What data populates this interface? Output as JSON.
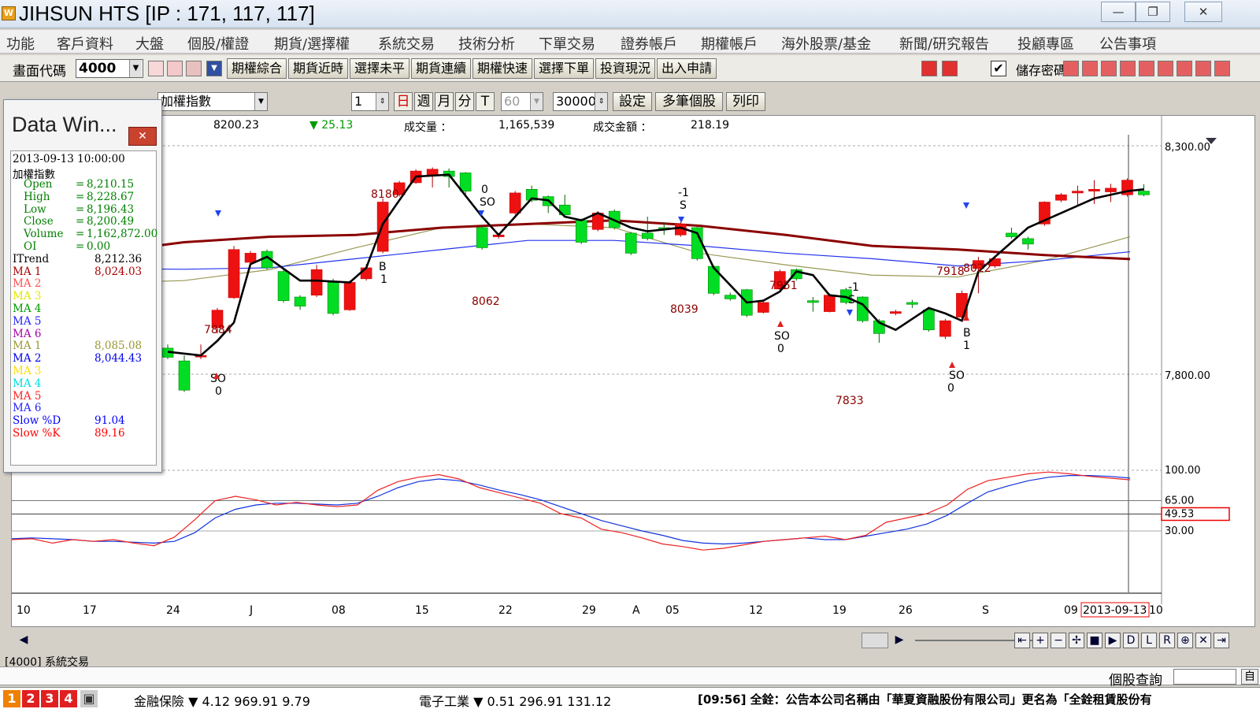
{
  "window": {
    "logo": "W",
    "title": "JIHSUN HTS      [IP : 171, 117, 117]",
    "min_glyph": "—",
    "max_glyph": "❐",
    "close_glyph": "✕"
  },
  "menu": [
    "功能",
    "客戶資料",
    "大盤",
    "個股/權證",
    "期貨/選擇權",
    "系統交易",
    "技術分析",
    "下單交易",
    "證券帳戶",
    "期權帳戶",
    "海外股票/基金",
    "新聞/研究報告",
    "投顧專區",
    "公告事項"
  ],
  "toolbar": {
    "code_label": "畫面代碼",
    "code_value": "4000",
    "buttons": [
      "期權綜合",
      "期貨近時",
      "選擇未平",
      "期貨連續",
      "期權快速",
      "選擇下單",
      "投資現況",
      "出入申請"
    ],
    "save_label": "儲存密碼"
  },
  "options": {
    "index_select": "加權指數",
    "count_value": "1",
    "periods": [
      "日",
      "週",
      "月",
      "分",
      "T"
    ],
    "minute_value": "60",
    "bars_value": "30000",
    "buttons": [
      "設定",
      "多筆個股",
      "列印"
    ]
  },
  "info": {
    "price": "8200.23",
    "change": "▼ 25.13",
    "volume_label": "成交量 ：",
    "volume": "1,165,539",
    "amount_label": "成交金額 ：",
    "amount": "218.19"
  },
  "colors": {
    "up": "#ee1111",
    "down": "#00dd22",
    "ma_long": "#8b0000",
    "ma_blue": "#2233ee",
    "ma_olive": "#999955",
    "itrend": "#000000",
    "slow_d": "#1133dd",
    "slow_k": "#ee2222"
  },
  "data_window": {
    "title": "Data Win...",
    "datetime": "2013-09-13  10:00:00",
    "symbol": "加權指數",
    "fields": [
      {
        "label": "Open",
        "value": "8,210.15",
        "color": "#008000"
      },
      {
        "label": "High",
        "value": "8,228.67",
        "color": "#008000"
      },
      {
        "label": "Low",
        "value": "8,196.43",
        "color": "#008000"
      },
      {
        "label": "Close",
        "value": "8,200.49",
        "color": "#008000"
      },
      {
        "label": "Volume",
        "value": "1,162,872.00",
        "color": "#008000"
      },
      {
        "label": "OI",
        "value": "0.00",
        "color": "#008000"
      }
    ],
    "indicators": [
      {
        "label": "ITrend",
        "value": "8,212.36",
        "color": "#000000"
      },
      {
        "label": "MA 1",
        "value": "8,024.03",
        "color": "#aa0000"
      },
      {
        "label": "MA 2",
        "value": "",
        "color": "#ff5050"
      },
      {
        "label": "MA 3",
        "value": "",
        "color": "#e6e600"
      },
      {
        "label": "MA 4",
        "value": "",
        "color": "#009900"
      },
      {
        "label": "MA 5",
        "value": "",
        "color": "#2222ff"
      },
      {
        "label": "MA 6",
        "value": "",
        "color": "#aa00aa"
      },
      {
        "label": "MA 1",
        "value": "8,085.08",
        "color": "#999933"
      },
      {
        "label": "MA 2",
        "value": "8,044.43",
        "color": "#0000ee"
      },
      {
        "label": "MA 3",
        "value": "",
        "color": "#ffdd00"
      },
      {
        "label": "MA 4",
        "value": "",
        "color": "#00dddd"
      },
      {
        "label": "MA 5",
        "value": "",
        "color": "#ff2222"
      },
      {
        "label": "MA 6",
        "value": "",
        "color": "#2222ff"
      },
      {
        "label": "Slow %D",
        "value": "91.04",
        "color": "#0000ff"
      },
      {
        "label": "Slow %K",
        "value": "89.16",
        "color": "#ff0000"
      }
    ]
  },
  "chart_data": {
    "type": "candlestick",
    "y_range": [
      7700,
      8330
    ],
    "y_ticks": [
      "8,300.00",
      "7,800.00"
    ],
    "x_labels": [
      "10",
      "17",
      "24",
      "J",
      "08",
      "15",
      "22",
      "29",
      "A",
      "05",
      "12",
      "19",
      "26",
      "S",
      "09",
      "2013-09-13",
      "10"
    ],
    "candles": [
      {
        "o": 7780,
        "c": 7755,
        "h": 7790,
        "l": 7750
      },
      {
        "o": 7745,
        "c": 7665,
        "h": 7760,
        "l": 7660
      },
      {
        "o": 7756,
        "c": 7760,
        "h": 7790,
        "l": 7750
      },
      {
        "o": 7836,
        "c": 7884,
        "h": 7890,
        "l": 7820
      },
      {
        "o": 7918,
        "c": 8050,
        "h": 8060,
        "l": 7915
      },
      {
        "o": 8015,
        "c": 8040,
        "h": 8046,
        "l": 8012
      },
      {
        "o": 8045,
        "c": 8000,
        "h": 8050,
        "l": 7995
      },
      {
        "o": 7990,
        "c": 7910,
        "h": 8000,
        "l": 7905
      },
      {
        "o": 7920,
        "c": 7895,
        "h": 7925,
        "l": 7885
      },
      {
        "o": 7925,
        "c": 7995,
        "h": 8008,
        "l": 7920
      },
      {
        "o": 7960,
        "c": 7875,
        "h": 7970,
        "l": 7870
      },
      {
        "o": 7885,
        "c": 7960,
        "h": 7965,
        "l": 7882
      },
      {
        "o": 7970,
        "c": 8000,
        "h": 8010,
        "l": 7965
      },
      {
        "o": 8045,
        "c": 8180,
        "h": 8190,
        "l": 8040
      },
      {
        "o": 8200,
        "c": 8233,
        "h": 8238,
        "l": 8195
      },
      {
        "o": 8233,
        "c": 8265,
        "h": 8270,
        "l": 8230
      },
      {
        "o": 8255,
        "c": 8270,
        "h": 8275,
        "l": 8220
      },
      {
        "o": 8265,
        "c": 8250,
        "h": 8272,
        "l": 8220
      },
      {
        "o": 8260,
        "c": 8210,
        "h": 8262,
        "l": 8200
      },
      {
        "o": 8110,
        "c": 8055,
        "h": 8115,
        "l": 8050
      },
      {
        "o": 8085,
        "c": 8090,
        "h": 8095,
        "l": 8080
      },
      {
        "o": 8150,
        "c": 8205,
        "h": 8210,
        "l": 8145
      },
      {
        "o": 8215,
        "c": 8185,
        "h": 8225,
        "l": 8180
      },
      {
        "o": 8195,
        "c": 8170,
        "h": 8198,
        "l": 8150
      },
      {
        "o": 8172,
        "c": 8145,
        "h": 8200,
        "l": 8140
      },
      {
        "o": 8130,
        "c": 8070,
        "h": 8135,
        "l": 8065
      },
      {
        "o": 8105,
        "c": 8150,
        "h": 8155,
        "l": 8100
      },
      {
        "o": 8155,
        "c": 8110,
        "h": 8160,
        "l": 8105
      },
      {
        "o": 8095,
        "c": 8040,
        "h": 8098,
        "l": 8035
      },
      {
        "o": 8095,
        "c": 8080,
        "h": 8140,
        "l": 8075
      },
      {
        "o": 8110,
        "c": 8105,
        "h": 8125,
        "l": 8090
      },
      {
        "o": 8090,
        "c": 8120,
        "h": 8125,
        "l": 8085
      },
      {
        "o": 8110,
        "c": 8025,
        "h": 8112,
        "l": 8020
      },
      {
        "o": 8004,
        "c": 7930,
        "h": 8006,
        "l": 7925
      },
      {
        "o": 7925,
        "c": 7915,
        "h": 7932,
        "l": 7910
      },
      {
        "o": 7940,
        "c": 7870,
        "h": 7942,
        "l": 7865
      },
      {
        "o": 7878,
        "c": 7905,
        "h": 7910,
        "l": 7875
      },
      {
        "o": 7942,
        "c": 7990,
        "h": 7995,
        "l": 7938
      },
      {
        "o": 7995,
        "c": 7970,
        "h": 7998,
        "l": 7965
      },
      {
        "o": 7910,
        "c": 7905,
        "h": 7920,
        "l": 7880
      },
      {
        "o": 7880,
        "c": 7925,
        "h": 7930,
        "l": 7878
      },
      {
        "o": 7940,
        "c": 7905,
        "h": 7945,
        "l": 7900
      },
      {
        "o": 7920,
        "c": 7855,
        "h": 7922,
        "l": 7850
      },
      {
        "o": 7855,
        "c": 7820,
        "h": 7860,
        "l": 7795
      },
      {
        "o": 7875,
        "c": 7880,
        "h": 7885,
        "l": 7870
      },
      {
        "o": 7905,
        "c": 7900,
        "h": 7912,
        "l": 7890
      },
      {
        "o": 7885,
        "c": 7830,
        "h": 7890,
        "l": 7825
      },
      {
        "o": 7812,
        "c": 7855,
        "h": 7860,
        "l": 7805
      },
      {
        "o": 7865,
        "c": 7930,
        "h": 7938,
        "l": 7860
      },
      {
        "o": 7998,
        "c": 8020,
        "h": 8030,
        "l": 7930
      },
      {
        "o": 8005,
        "c": 8025,
        "h": 8030,
        "l": 8000
      },
      {
        "o": 8095,
        "c": 8085,
        "h": 8110,
        "l": 8080
      },
      {
        "o": 8080,
        "c": 8065,
        "h": 8085,
        "l": 8050
      },
      {
        "o": 8120,
        "c": 8180,
        "h": 8182,
        "l": 8115
      },
      {
        "o": 8185,
        "c": 8200,
        "h": 8205,
        "l": 8180
      },
      {
        "o": 8205,
        "c": 8210,
        "h": 8225,
        "l": 8170
      },
      {
        "o": 8210,
        "c": 8215,
        "h": 8240,
        "l": 8175
      },
      {
        "o": 8208,
        "c": 8218,
        "h": 8230,
        "l": 8180
      },
      {
        "o": 8200,
        "c": 8240,
        "h": 8245,
        "l": 8195
      },
      {
        "o": 8210,
        "c": 8200,
        "h": 8229,
        "l": 8196
      }
    ],
    "itrend_x": [
      0,
      2,
      3,
      4,
      5,
      6,
      8,
      9,
      11,
      12,
      13,
      15,
      17,
      19,
      20,
      22,
      23,
      24,
      25,
      26,
      27,
      28,
      29,
      30,
      31,
      32,
      33,
      35,
      36,
      37,
      38,
      39,
      40,
      41,
      42,
      43,
      44,
      45,
      46,
      47,
      48,
      49,
      50,
      52,
      54,
      56,
      58,
      59
    ],
    "itrend_y": [
      7770,
      7760,
      7800,
      7850,
      8010,
      8030,
      7965,
      7965,
      7960,
      8000,
      8120,
      8250,
      8255,
      8140,
      8090,
      8190,
      8185,
      8140,
      8130,
      8150,
      8130,
      8110,
      8100,
      8105,
      8110,
      8095,
      8000,
      7905,
      7910,
      7935,
      7990,
      7980,
      7925,
      7920,
      7900,
      7850,
      7830,
      7860,
      7890,
      7875,
      7855,
      7990,
      8030,
      8110,
      8150,
      8190,
      8210,
      8215
    ],
    "ma_long": [
      8005,
      8040,
      8070,
      8085,
      8090,
      8110,
      8120,
      8130,
      8115,
      8090,
      8060,
      8050,
      8035,
      8024
    ],
    "ma_blue": [
      8005,
      7998,
      7996,
      8000,
      8025,
      8050,
      8075,
      8075,
      8060,
      8040,
      8025,
      8005,
      8020,
      8044
    ],
    "ma_olive": [
      7975,
      7958,
      7965,
      7995,
      8055,
      8110,
      8120,
      8110,
      8040,
      8008,
      7980,
      7975,
      8020,
      8085
    ],
    "annotations": [
      {
        "text": "7884",
        "color": "#8b0000"
      },
      {
        "text": "8180",
        "color": "#8b0000"
      },
      {
        "text": "8062",
        "color": "#8b0000"
      },
      {
        "text": "8039",
        "color": "#8b0000"
      },
      {
        "text": "7951",
        "color": "#8b0000"
      },
      {
        "text": "7833",
        "color": "#8b0000"
      },
      {
        "text": "7918",
        "color": "#8b0000"
      },
      {
        "text": "8022",
        "color": "#8b0000"
      },
      {
        "text": "SO",
        "color": "#000000"
      },
      {
        "text": "0",
        "color": "#000000"
      },
      {
        "text": "B",
        "color": "#000000"
      },
      {
        "text": "1",
        "color": "#000000"
      },
      {
        "text": "0",
        "color": "#000000"
      },
      {
        "text": "SO",
        "color": "#000000"
      },
      {
        "text": "-1",
        "color": "#000000"
      },
      {
        "text": "S",
        "color": "#000000"
      },
      {
        "text": "SO",
        "color": "#000000"
      },
      {
        "text": "0",
        "color": "#000000"
      },
      {
        "text": "-1",
        "color": "#000000"
      },
      {
        "text": "S",
        "color": "#000000"
      },
      {
        "text": "SO",
        "color": "#000000"
      },
      {
        "text": "0",
        "color": "#000000"
      },
      {
        "text": "B",
        "color": "#000000"
      },
      {
        "text": "1",
        "color": "#000000"
      }
    ],
    "stoch": {
      "y_ticks": [
        "100.00",
        "65.00",
        "30.00"
      ],
      "current": "49.53",
      "k": [
        20,
        21,
        16,
        20,
        18,
        20,
        16,
        13,
        23,
        43,
        65,
        70,
        66,
        60,
        63,
        60,
        58,
        60,
        77,
        87,
        92,
        95,
        90,
        80,
        74,
        68,
        62,
        50,
        45,
        32,
        28,
        22,
        15,
        12,
        8,
        10,
        14,
        18,
        20,
        22,
        24,
        20,
        25,
        40,
        45,
        50,
        60,
        78,
        88,
        92,
        96,
        98,
        96,
        93,
        91,
        89
      ],
      "d": [
        21,
        22,
        21,
        20,
        18,
        18,
        17,
        16,
        18,
        28,
        45,
        55,
        60,
        62,
        62,
        61,
        60,
        62,
        70,
        80,
        87,
        90,
        88,
        83,
        77,
        72,
        66,
        58,
        50,
        42,
        36,
        30,
        25,
        19,
        16,
        15,
        16,
        18,
        20,
        22,
        20,
        20,
        24,
        28,
        32,
        38,
        48,
        62,
        75,
        82,
        88,
        92,
        94,
        94,
        93,
        91
      ]
    }
  },
  "status": {
    "tab_label": "[4000] 系統交易",
    "query_label": "個股查詢",
    "query_btn": "自"
  },
  "ticker": {
    "nums": [
      "1",
      "2",
      "3",
      "4"
    ],
    "item1": "金融保險 ▼  4.12  969.91    9.79",
    "item2": "電子工業 ▼  0.51  296.91   131.12",
    "news": "[09:56] 全銓：公告本公司名稱由「華夏資融股份有限公司」更名為「全銓租賃股份有"
  }
}
